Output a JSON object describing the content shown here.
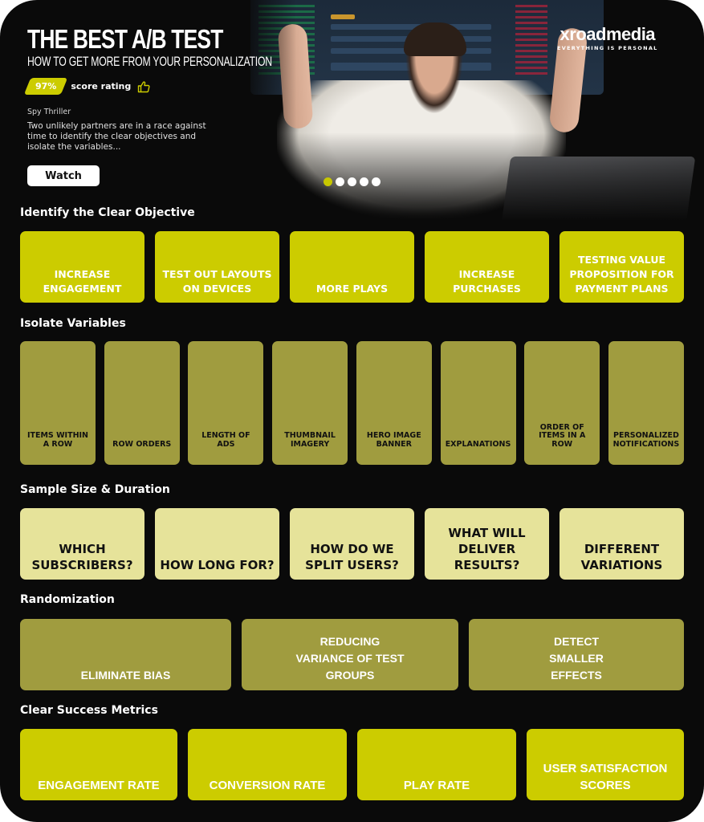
{
  "hero": {
    "title": "THE BEST A/B TEST",
    "subtitle": "HOW TO GET MORE FROM YOUR PERSONALIZATION",
    "score": "97%",
    "score_label": "score rating",
    "genre": "Spy Thriller",
    "description": "Two unlikely partners are in a race against time to identify the clear objectives and isolate the variables...",
    "watch_label": "Watch",
    "carousel": {
      "total": 5,
      "active": 1
    }
  },
  "brand": {
    "name": "xroadmedia",
    "tagline": "EVERYTHING IS PERSONAL"
  },
  "colors": {
    "accent": "#cccc00",
    "olive": "#a09c3f",
    "pale": "#e6e39a",
    "background": "#0a0a0a"
  },
  "sections": [
    {
      "title": "Identify the Clear Objective",
      "items": [
        "INCREASE ENGAGEMENT",
        "TEST OUT LAYOUTS ON DEVICES",
        "MORE PLAYS",
        "INCREASE PURCHASES",
        "TESTING VALUE PROPOSITION FOR PAYMENT PLANS"
      ]
    },
    {
      "title": "Isolate Variables",
      "items": [
        "ITEMS WITHIN A ROW",
        "ROW ORDERS",
        "LENGTH OF ADS",
        "THUMBNAIL IMAGERY",
        "HERO IMAGE BANNER",
        "EXPLANATIONS",
        "ORDER OF ITEMS IN A ROW",
        "PERSONALIZED NOTIFICATIONS"
      ]
    },
    {
      "title": "Sample Size & Duration",
      "items": [
        "WHICH SUBSCRIBERS?",
        "HOW LONG FOR?",
        "HOW DO WE SPLIT USERS?",
        "WHAT WILL DELIVER RESULTS?",
        "DIFFERENT VARIATIONS"
      ]
    },
    {
      "title": "Randomization",
      "items": [
        "ELIMINATE BIAS",
        "REDUCING VARIANCE OF TEST GROUPS",
        "DETECT SMALLER EFFECTS"
      ]
    },
    {
      "title": "Clear Success Metrics",
      "items": [
        "ENGAGEMENT RATE",
        "CONVERSION RATE",
        "PLAY RATE",
        "USER SATISFACTION SCORES"
      ]
    }
  ]
}
